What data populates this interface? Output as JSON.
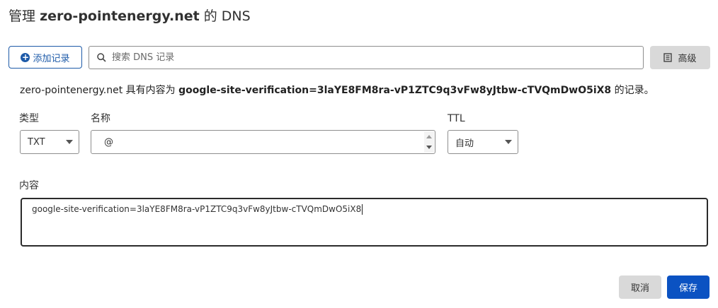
{
  "header": {
    "prefix": "管理",
    "domain": "zero-pointenergy.net",
    "suffix": "的 DNS"
  },
  "toolbar": {
    "add_record_label": "添加记录",
    "search_placeholder": "搜索 DNS 记录",
    "advanced_label": "高级"
  },
  "info": {
    "domain": "zero-pointenergy.net",
    "middle": "具有内容为",
    "content": "google-site-verification=3laYE8FM8ra-vP1ZTC9q3vFw8yJtbw-cTVQmDwO5iX8",
    "tail": "的记录。"
  },
  "form": {
    "type_label": "类型",
    "type_value": "TXT",
    "name_label": "名称",
    "name_value": "@",
    "ttl_label": "TTL",
    "ttl_value": "自动",
    "content_label": "内容",
    "content_value": "google-site-verification=3laYE8FM8ra-vP1ZTC9q3vFw8yJtbw-cTVQmDwO5iX8"
  },
  "actions": {
    "cancel_label": "取消",
    "save_label": "保存"
  },
  "colors": {
    "accent": "#1d5aa8",
    "primary_button": "#0b52c2",
    "secondary_button": "#d9d9d9"
  },
  "icons": {
    "add": "plus-circle-icon",
    "search": "search-icon",
    "advanced": "document-icon",
    "select": "chevron-down-icon"
  }
}
